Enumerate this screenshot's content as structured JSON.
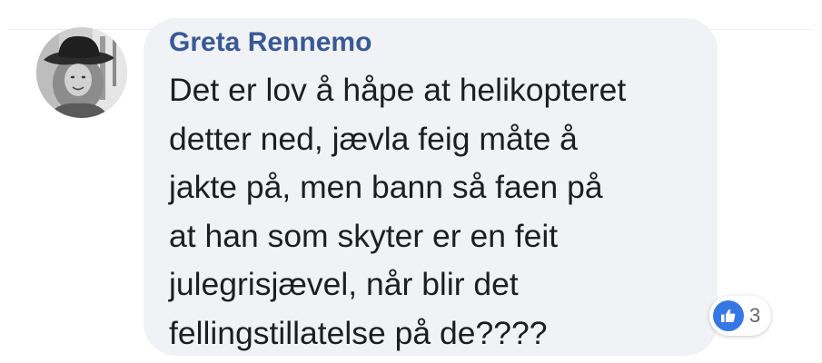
{
  "comment": {
    "author": "Greta Rennemo",
    "text_lines": [
      "Det er lov å håpe at helikopteret",
      "detter ned, jævla feig måte å",
      "jakte på, men bann så faen på",
      "at han som skyter er en feit",
      "julegrisjævel, når blir det",
      "fellingstillatelse på de????"
    ],
    "reactions": {
      "icon": "thumbs-up-icon",
      "count": "3"
    }
  },
  "colors": {
    "author_name": "#385898",
    "bubble_background": "#f0f2f5",
    "text": "#1c1e21",
    "like_icon": "#3578e5"
  }
}
